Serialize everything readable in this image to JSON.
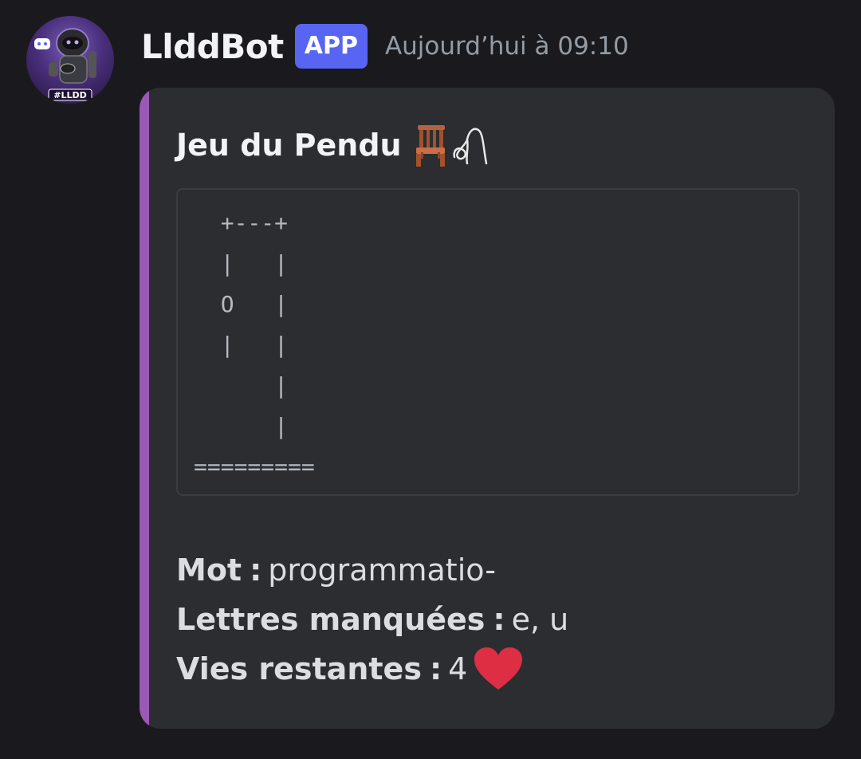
{
  "message": {
    "author": "LlddBot",
    "badge": "APP",
    "timestamp": "Aujourd’hui à 09:10",
    "avatar_text": "#LLDD"
  },
  "embed": {
    "accent_color": "#9b59b6",
    "title": "Jeu du Pendu",
    "title_icons": [
      "chair-icon",
      "rope-icon"
    ],
    "hangman_art": "  +---+\n  |   |\n  O   |\n  |   |\n      |\n      |\n=========",
    "fields": [
      {
        "label": "Mot",
        "separator": ":",
        "value": "programmatio-"
      },
      {
        "label": "Lettres manquées",
        "separator": ":",
        "value": "e, u"
      },
      {
        "label": "Vies restantes",
        "separator": ":",
        "value": "4",
        "icon": "heart-icon"
      }
    ]
  },
  "colors": {
    "background": "#1a1a1e",
    "embed_background": "#2b2d31",
    "badge": "#5865f2",
    "heart": "#dd2e44"
  }
}
